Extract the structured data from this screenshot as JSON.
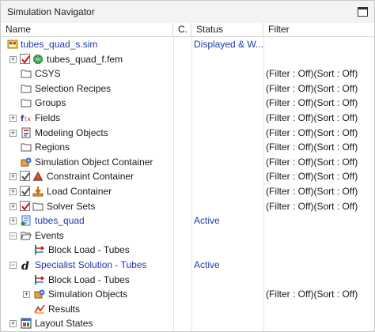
{
  "panel": {
    "title": "Simulation Navigator"
  },
  "columns": {
    "name": "Name",
    "c": "C.",
    "status": "Status",
    "filter": "Filter"
  },
  "rows": [
    {
      "label": "tubes_quad_s.sim",
      "status": "Displayed & W...",
      "filter": ""
    },
    {
      "label": "tubes_quad_f.fem",
      "status": "",
      "filter": ""
    },
    {
      "label": "CSYS",
      "status": "",
      "filter": "(Filter : Off)(Sort : Off)"
    },
    {
      "label": "Selection Recipes",
      "status": "",
      "filter": "(Filter : Off)(Sort : Off)"
    },
    {
      "label": "Groups",
      "status": "",
      "filter": "(Filter : Off)(Sort : Off)"
    },
    {
      "label": "Fields",
      "status": "",
      "filter": "(Filter : Off)(Sort : Off)"
    },
    {
      "label": "Modeling Objects",
      "status": "",
      "filter": "(Filter : Off)(Sort : Off)"
    },
    {
      "label": "Regions",
      "status": "",
      "filter": "(Filter : Off)(Sort : Off)"
    },
    {
      "label": "Simulation Object Container",
      "status": "",
      "filter": "(Filter : Off)(Sort : Off)"
    },
    {
      "label": "Constraint Container",
      "status": "",
      "filter": "(Filter : Off)(Sort : Off)"
    },
    {
      "label": "Load Container",
      "status": "",
      "filter": "(Filter : Off)(Sort : Off)"
    },
    {
      "label": "Solver Sets",
      "status": "",
      "filter": "(Filter : Off)(Sort : Off)"
    },
    {
      "label": "tubes_quad",
      "status": "Active",
      "filter": ""
    },
    {
      "label": "Events",
      "status": "",
      "filter": ""
    },
    {
      "label": "Block Load - Tubes",
      "status": "",
      "filter": ""
    },
    {
      "label": "Specialist Solution - Tubes",
      "status": "Active",
      "filter": ""
    },
    {
      "label": "Block Load - Tubes",
      "status": "",
      "filter": ""
    },
    {
      "label": "Simulation Objects",
      "status": "",
      "filter": "(Filter : Off)(Sort : Off)"
    },
    {
      "label": "Results",
      "status": "",
      "filter": ""
    },
    {
      "label": "Layout States",
      "status": "",
      "filter": ""
    }
  ],
  "icons": {
    "sim": "sim-file-icon",
    "fem": "fem-file-icon",
    "folder": "folder-icon",
    "fields": "fields-icon",
    "modeling": "modeling-objects-icon",
    "simobj": "simulation-object-container-icon",
    "constraint": "constraint-icon",
    "load": "load-icon",
    "solver": "solver-sets-icon",
    "solution": "solution-icon",
    "specialist": "specialist-solution-icon",
    "blockload": "block-load-icon",
    "results": "results-icon",
    "layout": "layout-states-icon"
  }
}
